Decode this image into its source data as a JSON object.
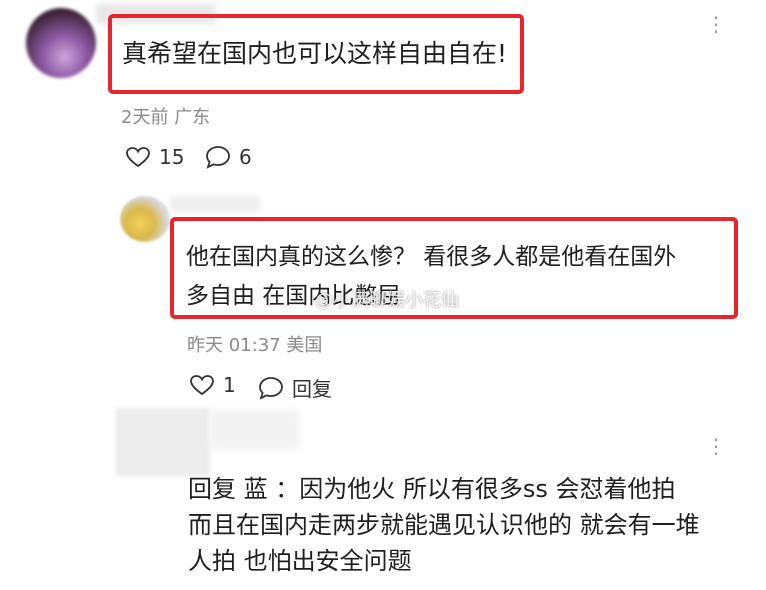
{
  "comment1": {
    "text": "真希望在国内也可以这样自由自在!",
    "time": "2天前",
    "location": "广东",
    "likes": "15",
    "replies": "6"
  },
  "comment2": {
    "text_line1": "他在国内真的这么惨？ 看很多人都是他看在国外",
    "text_line2": "多自由 在国内比憋屈",
    "time": "昨天 01:37",
    "location": "美国",
    "likes": "1",
    "reply_label": "回复"
  },
  "watermark": "@小满聊娱小花仙",
  "comment3": {
    "line1": "回复 蓝    ：因为他火 所以有很多ss 会怼着他拍",
    "line2": "而且在国内走两步就能遇见认识他的 就会有一堆",
    "line3": "人拍 也怕出安全问题"
  },
  "more_glyph": "⋮"
}
